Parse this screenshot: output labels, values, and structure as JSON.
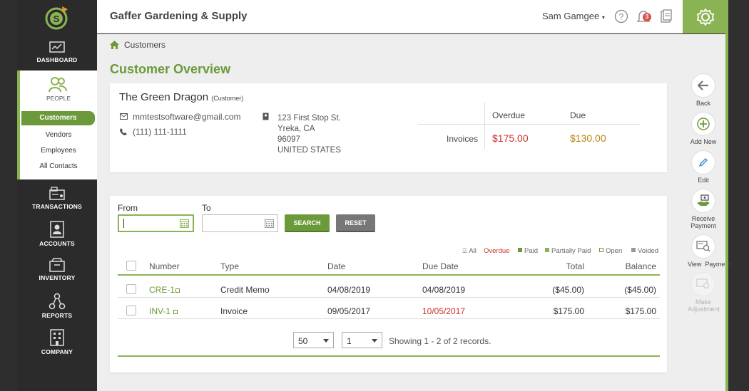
{
  "header": {
    "company": "Gaffer Gardening & Supply",
    "user": "Sam Gamgee",
    "notification_count": "3"
  },
  "sidebar": {
    "dashboard": "DASHBOARD",
    "people": "PEOPLE",
    "people_items": [
      "Customers",
      "Vendors",
      "Employees",
      "All Contacts"
    ],
    "transactions": "TRANSACTIONS",
    "accounts": "ACCOUNTS",
    "inventory": "INVENTORY",
    "reports": "REPORTS",
    "company": "COMPANY"
  },
  "breadcrumb": "Customers",
  "page_title": "Customer Overview",
  "customer": {
    "name": "The Green Dragon",
    "type": "(Customer)",
    "email": "mmtestsoftware@gmail.com",
    "phone": "(111) 111-1111",
    "address": [
      "123 First Stop St.",
      "Yreka, CA",
      "96097",
      "UNITED STATES"
    ]
  },
  "summary": {
    "overdue_label": "Overdue",
    "due_label": "Due",
    "row_label": "Invoices",
    "overdue": "$175.00",
    "due": "$130.00"
  },
  "filter": {
    "from_label": "From",
    "to_label": "To",
    "search": "SEARCH",
    "reset": "RESET"
  },
  "legend": [
    "All",
    "Overdue",
    "Paid",
    "Partially Paid",
    "Open",
    "Voided"
  ],
  "table": {
    "headers": [
      "Number",
      "Type",
      "Date",
      "Due Date",
      "Total",
      "Balance"
    ],
    "rows": [
      {
        "number": "CRE-1",
        "type": "Credit Memo",
        "date": "04/08/2019",
        "due": "04/08/2019",
        "total": "($45.00)",
        "balance": "($45.00)"
      },
      {
        "number": "INV-1",
        "type": "Invoice",
        "date": "09/05/2017",
        "due": "10/05/2017",
        "total": "$175.00",
        "balance": "$175.00"
      }
    ]
  },
  "pagination": {
    "per_page": "50",
    "page": "1",
    "showing": "Showing 1 - 2 of 2 records."
  },
  "actions": {
    "back": "Back",
    "add_new": "Add New",
    "edit": "Edit",
    "receive": "Receive Payment",
    "view": "View  Payment",
    "adjust": "Make Adjustment"
  },
  "colors": {
    "green": "#6c9a3a",
    "red": "#c9302c",
    "gold": "#b8860b"
  }
}
